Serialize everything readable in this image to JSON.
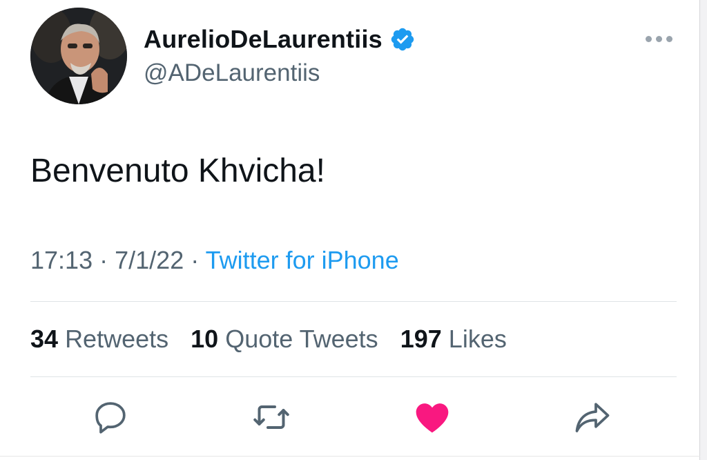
{
  "tweet": {
    "author_name": "AurelioDeLaurentiis",
    "author_handle": "@ADeLaurentiis",
    "text": "Benvenuto Khvicha!",
    "time": "17:13",
    "date": "7/1/22",
    "separator": "·",
    "source": "Twitter for iPhone"
  },
  "stats": {
    "retweets_count": "34",
    "retweets_label": "Retweets",
    "quotes_count": "10",
    "quotes_label": "Quote Tweets",
    "likes_count": "197",
    "likes_label": "Likes"
  },
  "icons": {
    "verified": "verified-badge-icon",
    "more": "more-options-icon",
    "reply": "reply-icon",
    "retweet": "retweet-icon",
    "like": "heart-icon",
    "share": "share-icon"
  },
  "colors": {
    "accent": "#1d9bf0",
    "like": "#f91880",
    "text": "#0f1419",
    "secondary": "#536471"
  }
}
